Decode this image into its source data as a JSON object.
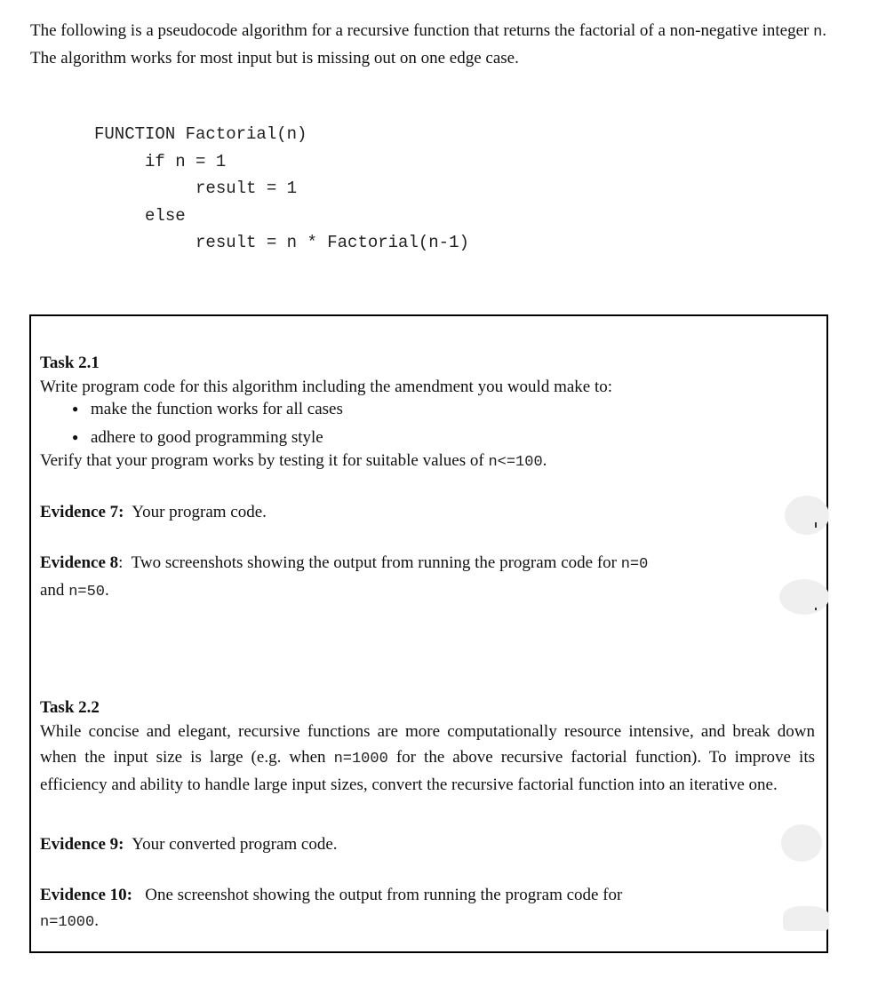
{
  "intro": {
    "text_before": "The following is a pseudocode algorithm for a recursive function that returns the factorial of a non-negative integer ",
    "code_var": "n",
    "text_after": ". The algorithm works for most input but is missing out on one edge case."
  },
  "pseudocode": {
    "lines": [
      "FUNCTION Factorial(n)",
      "     if n = 1",
      "          result = 1",
      "     else",
      "          result = n * Factorial(n-1)"
    ]
  },
  "task_2_1": {
    "title": "Task 2.1",
    "instruction": "Write program code for this algorithm including the amendment you would make to:",
    "bullets": [
      "make the function works for all cases",
      "adhere to good programming style"
    ],
    "bullet_glyph": "●",
    "verify_text": "Verify that your program works by testing it for suitable values of ",
    "verify_code": "n<=100",
    "verify_end": ".",
    "evidence": [
      {
        "label": "Evidence 7:",
        "text": "Your program code."
      },
      {
        "label": "Evidence 8",
        "sep": ":",
        "text": "Two screenshots showing the output from running the program code for ",
        "code1": "n=0",
        "mid": "and ",
        "code2": "n=50",
        "end": "."
      }
    ]
  },
  "task_2_2": {
    "title": "Task 2.2",
    "para_before": "While concise and elegant, recursive functions are more computationally resource intensive, and break down when the input size is large (e.g. when ",
    "para_code": "n=1000",
    "para_after": " for the above recursive factorial function). To improve its efficiency and ability to handle large input sizes, convert the recursive factorial function into an iterative one.",
    "evidence": [
      {
        "label": "Evidence 9:",
        "text": "Your converted program code."
      },
      {
        "label": "Evidence 10:",
        "text": "One screenshot showing the output from running the program code for ",
        "code": "n=1000",
        "end": "."
      }
    ]
  }
}
